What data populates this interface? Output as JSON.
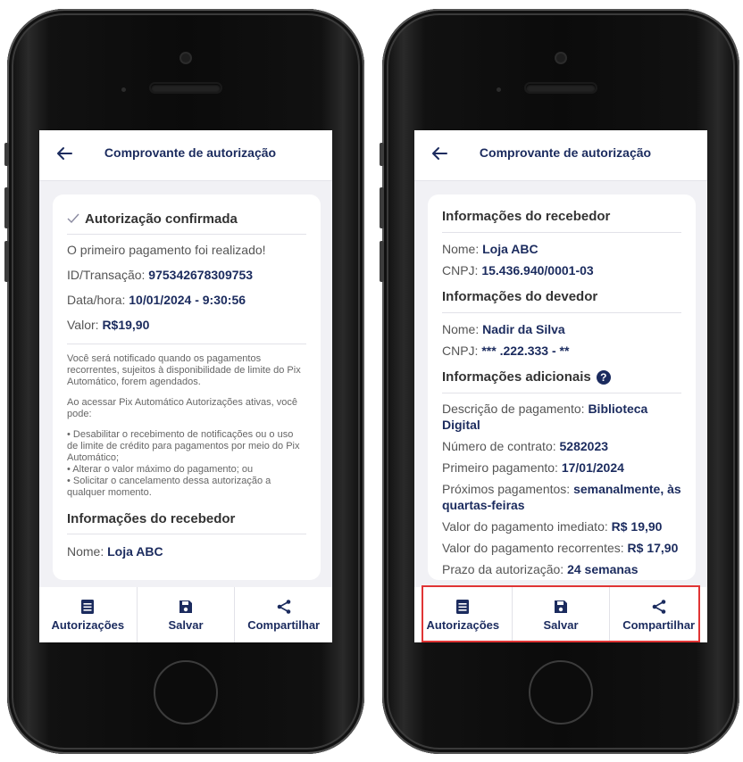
{
  "left": {
    "header": {
      "title": "Comprovante de autorização"
    },
    "status": "Autorização confirmada",
    "lines": [
      {
        "label": "O primeiro pagamento foi realizado!",
        "value": ""
      },
      {
        "label": "ID/Transação: ",
        "value": "975342678309753"
      },
      {
        "label": "Data/hora: ",
        "value": "10/01/2024 - 9:30:56"
      },
      {
        "label": "Valor: ",
        "value": "R$19,90"
      }
    ],
    "notice_1": "Você será notificado quando os pagamentos recorrentes, sujeitos à disponibilidade de limite do Pix Automático, forem agendados.",
    "notice_2": "Ao acessar Pix Automático Autorizações ativas, você pode:",
    "notice_3": "• Desabilitar o recebimento de notificações ou o uso de limite de crédito para pagamentos por meio do Pix Automático;",
    "notice_4": "• Alterar o valor máximo do pagamento; ou",
    "notice_5": "• Solicitar o cancelamento dessa autorização a qualquer momento.",
    "section_receiver": "Informações do recebedor",
    "receiver_name_label": "Nome: ",
    "receiver_name": "Loja ABC",
    "toolbar": {
      "authorizations": "Autorizações",
      "save": "Salvar",
      "share": "Compartilhar"
    }
  },
  "right": {
    "header": {
      "title": "Comprovante de autorização"
    },
    "section_receiver": "Informações do recebedor",
    "receiver": [
      {
        "label": "Nome: ",
        "value": "Loja ABC"
      },
      {
        "label": "CNPJ: ",
        "value": "15.436.940/0001-03"
      }
    ],
    "section_debtor": "Informações do devedor",
    "debtor": [
      {
        "label": "Nome: ",
        "value": "Nadir da Silva"
      },
      {
        "label": "CNPJ: ",
        "value": "*** .222.333 - **"
      }
    ],
    "section_additional": "Informações adicionais",
    "help_symbol": "?",
    "additional": [
      {
        "label": "Descrição de pagamento: ",
        "value": "Biblioteca Digital"
      },
      {
        "label": "Número de contrato: ",
        "value": "5282023"
      },
      {
        "label": "Primeiro pagamento: ",
        "value": "17/01/2024"
      },
      {
        "label": "Próximos pagamentos: ",
        "value": "semanalmente, às quartas-feiras"
      },
      {
        "label": "Valor do pagamento imediato: ",
        "value": "R$ 19,90"
      },
      {
        "label": "Valor do pagamento recorrentes: ",
        "value": "R$ 17,90"
      },
      {
        "label": "Prazo da autorização: ",
        "value": "24 semanas"
      }
    ],
    "toolbar": {
      "authorizations": "Autorizações",
      "save": "Salvar",
      "share": "Compartilhar"
    }
  },
  "colors": {
    "accent": "#1b2b5e",
    "highlight": "#e03535",
    "background": "#f1f1f5"
  }
}
